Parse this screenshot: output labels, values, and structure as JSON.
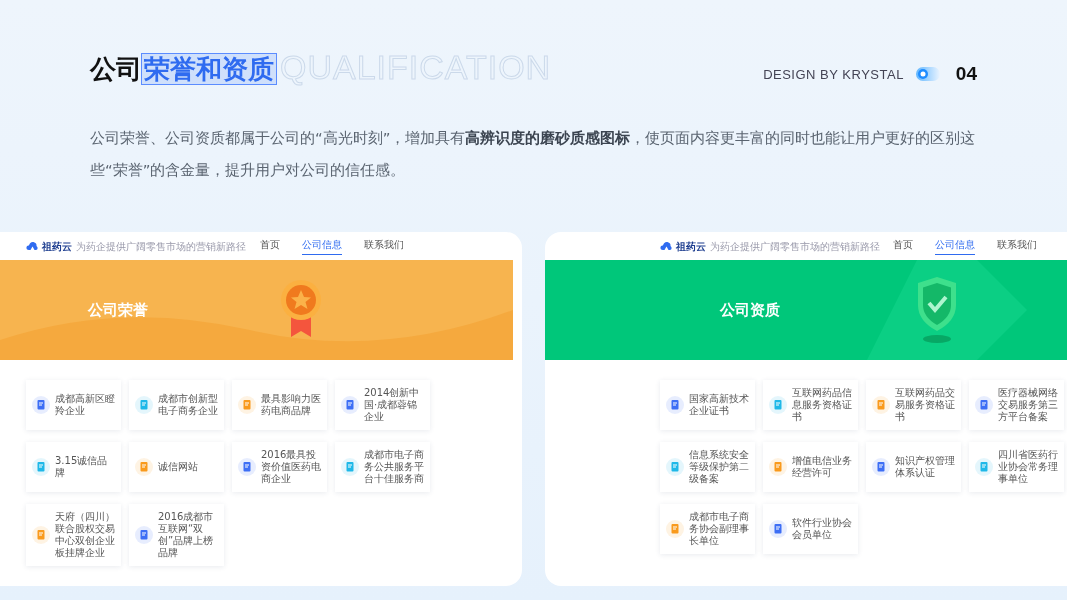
{
  "header": {
    "title": "公司",
    "title_highlight": "荣誉和资质",
    "outline_text": "QUALIFICATION",
    "credit": "DESIGN BY KRYSTAL",
    "page_number": "04"
  },
  "intro": "公司荣誉、公司资质都属于公司的“高光时刻”，增加具有**高辨识度的磨砂质感图标**，使页面内容更丰富的同时也能让用户更好的区别这些“荣誉”的含金量，提升用户对公司的信任感。",
  "mockups": [
    {
      "logo": "祖药云",
      "tagline": "为药企提供广阔零售市场的营销新路径",
      "nav": [
        {
          "label": "首页",
          "selected": false
        },
        {
          "label": "公司信息",
          "selected": true
        },
        {
          "label": "联系我们",
          "selected": false
        }
      ],
      "banner": {
        "title": "公司荣誉",
        "kind": "medal"
      },
      "cards": [
        {
          "text": "成都高新区瞪羚企业",
          "color": "#3d6ef5"
        },
        {
          "text": "成都市创新型电子商务企业",
          "color": "#1fb8e8"
        },
        {
          "text": "最具影响力医药电商品牌",
          "color": "#f99a1c"
        },
        {
          "text": "2014创新中国·成都蓉锦企业",
          "color": "#3d6ef5"
        },
        {
          "text": "3.15诚信品牌",
          "color": "#1fb8e8"
        },
        {
          "text": "诚信网站",
          "color": "#f99a1c"
        },
        {
          "text": "2016最具投资价值医药电商企业",
          "color": "#3d6ef5"
        },
        {
          "text": "成都市电子商务公共服务平台十佳服务商",
          "color": "#1fb8e8"
        },
        {
          "text": "天府（四川）联合股权交易中心双创企业板挂牌企业",
          "color": "#f99a1c"
        },
        {
          "text": "2016成都市互联网“双创”品牌上榜品牌",
          "color": "#3d6ef5"
        }
      ]
    },
    {
      "logo": "祖药云",
      "tagline": "为药企提供广阔零售市场的营销新路径",
      "nav": [
        {
          "label": "首页",
          "selected": false
        },
        {
          "label": "公司信息",
          "selected": true
        },
        {
          "label": "联系我们",
          "selected": false
        }
      ],
      "banner": {
        "title": "公司资质",
        "kind": "shield"
      },
      "cards": [
        {
          "text": "国家高新技术企业证书",
          "color": "#3d6ef5"
        },
        {
          "text": "互联网药品信息服务资格证书",
          "color": "#1fb8e8"
        },
        {
          "text": "互联网药品交易服务资格证书",
          "color": "#f99a1c"
        },
        {
          "text": "医疗器械网络交易服务第三方平台备案",
          "color": "#3d6ef5"
        },
        {
          "text": "信息系统安全等级保护第二级备案",
          "color": "#1fb8e8"
        },
        {
          "text": "增值电信业务经营许可",
          "color": "#f99a1c"
        },
        {
          "text": "知识产权管理体系认证",
          "color": "#3d6ef5"
        },
        {
          "text": "四川省医药行业协会常务理事单位",
          "color": "#1fb8e8"
        },
        {
          "text": "成都市电子商务协会副理事长单位",
          "color": "#f99a1c"
        },
        {
          "text": "软件行业协会会员单位",
          "color": "#3d6ef5"
        }
      ]
    }
  ]
}
